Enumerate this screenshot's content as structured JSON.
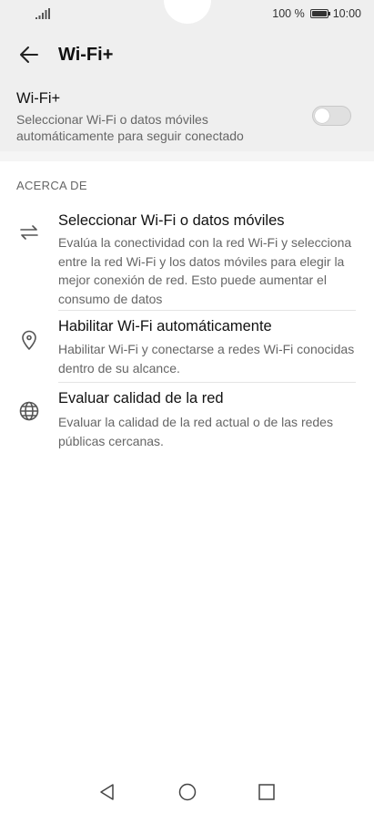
{
  "status_bar": {
    "battery_text": "100 %",
    "time": "10:00",
    "battery_level": 1.0
  },
  "app_bar": {
    "back_icon": "arrow-left-icon",
    "title": "Wi-Fi+"
  },
  "toggle": {
    "title": "Wi-Fi+",
    "description": "Seleccionar Wi-Fi o datos móviles automáticamente para seguir conectado",
    "enabled": false
  },
  "about": {
    "header": "ACERCA DE",
    "items": [
      {
        "icon": "swap-arrows-icon",
        "title": "Seleccionar Wi-Fi o datos móviles",
        "description": "Evalúa la conectividad con la red Wi-Fi y selecciona entre la red Wi-Fi y los datos móviles para elegir la mejor conexión de red. Esto puede aumentar el consumo de datos"
      },
      {
        "icon": "location-pin-icon",
        "title": "Habilitar Wi-Fi automáticamente",
        "description": "Habilitar Wi-Fi y conectarse a redes Wi-Fi conocidas dentro de su alcance."
      },
      {
        "icon": "globe-icon",
        "title": "Evaluar calidad de la red",
        "description": "Evaluar la calidad de la red actual o de las redes públicas cercanas."
      }
    ]
  },
  "nav_bar": {
    "back": "triangle-back-icon",
    "home": "circle-home-icon",
    "recents": "square-recents-icon"
  }
}
